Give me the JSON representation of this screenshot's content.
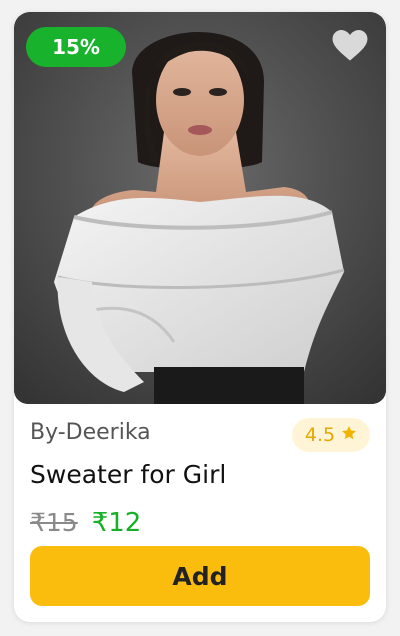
{
  "product": {
    "discount_badge": "15%",
    "brand": "By-Deerika",
    "rating": "4.5",
    "title": "Sweater for Girl",
    "original_price": "₹15",
    "sale_price": "₹12",
    "add_button_label": "Add"
  },
  "icons": {
    "favorite": "heart-icon",
    "rating": "star-icon"
  },
  "colors": {
    "discount_badge_bg": "#19b22c",
    "favorite_icon": "#d9d9d9",
    "rating_pill_bg": "#fff5d6",
    "rating_text": "#e6a800",
    "sale_price": "#14b125",
    "old_price": "#8a8a8a",
    "add_button_bg": "#fbbd0d"
  }
}
